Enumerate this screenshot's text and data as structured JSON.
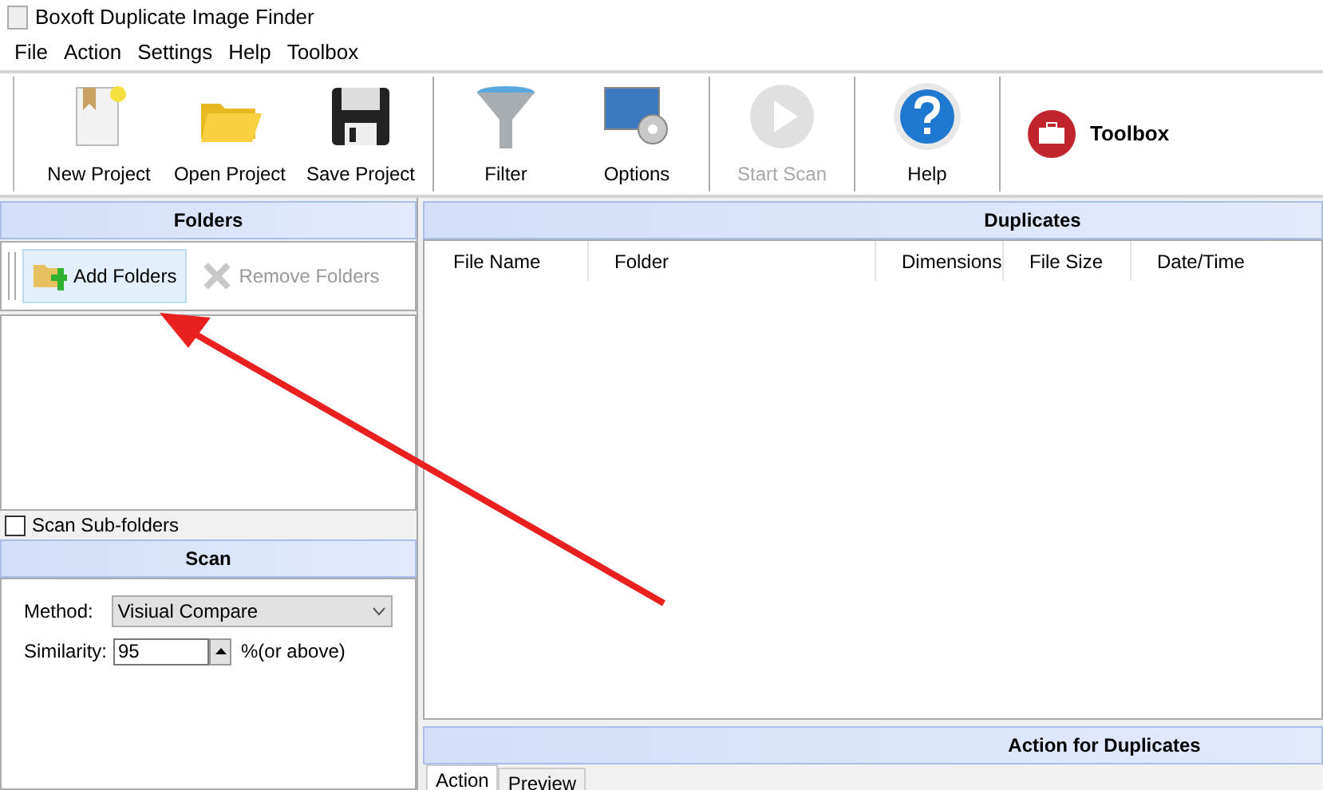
{
  "window": {
    "title": "Boxoft Duplicate Image Finder"
  },
  "menu": [
    "File",
    "Action",
    "Settings",
    "Help",
    "Toolbox"
  ],
  "toolbar_groups": [
    [
      {
        "label": "New Project",
        "disabled": false
      },
      {
        "label": "Open Project",
        "disabled": false
      },
      {
        "label": "Save Project",
        "disabled": false
      }
    ],
    [
      {
        "label": "Filter",
        "disabled": false
      },
      {
        "label": "Options",
        "disabled": false
      }
    ],
    [
      {
        "label": "Start Scan",
        "disabled": true
      }
    ],
    [
      {
        "label": "Help",
        "disabled": false
      }
    ],
    [
      {
        "label": "Toolbox",
        "disabled": false
      }
    ]
  ],
  "folders": {
    "title": "Folders",
    "buttons": [
      {
        "label": "Add Folders",
        "disabled": false
      },
      {
        "label": "Remove Folders",
        "disabled": true
      }
    ],
    "scan_subfolders": {
      "label": "Scan Sub-folders",
      "checked": false
    }
  },
  "scan": {
    "title": "Scan",
    "method": {
      "label": "Method:",
      "value": "Visiual Compare"
    },
    "similarity": {
      "label": "Similarity:",
      "value": "95",
      "suffix": "%(or above)"
    }
  },
  "duplicates": {
    "title": "Duplicates",
    "columns": [
      "File Name",
      "Folder",
      "Dimensions",
      "File Size",
      "Date/Time"
    ]
  },
  "action_panel": {
    "title": "Action for Duplicates",
    "tabs": [
      {
        "label": "Action",
        "selected": true
      },
      {
        "label": "Preview",
        "selected": false
      }
    ]
  }
}
